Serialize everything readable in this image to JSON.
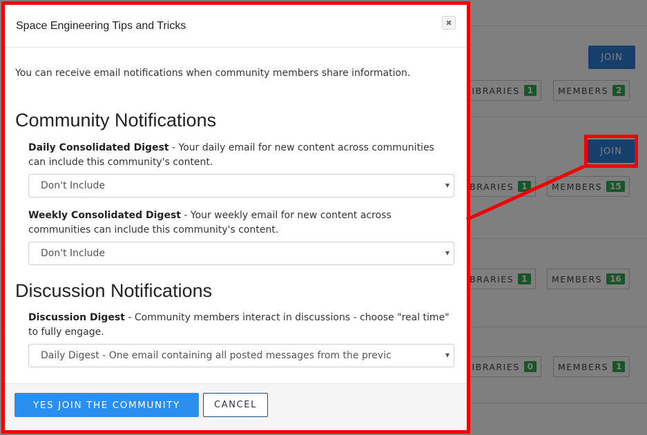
{
  "background": {
    "join_label": "JOIN",
    "libraries_label": "LIBRARIES",
    "members_label": "MEMBERS",
    "libraries_label_clipped": "IBRARIES",
    "rows": [
      {
        "libraries": "1",
        "members": "2"
      },
      {
        "libraries": "1",
        "members": "15"
      },
      {
        "libraries": "1",
        "members": "16"
      },
      {
        "libraries": "0",
        "members": "1"
      }
    ]
  },
  "modal": {
    "title": "Space Engineering Tips and Tricks",
    "close_symbol": "✖",
    "intro": "You can receive email notifications when community members share information.",
    "community_heading": "Community Notifications",
    "daily": {
      "label": "Daily Consolidated Digest",
      "desc": " - Your daily email for new content across communities can include this community's content.",
      "selected": "Don't Include"
    },
    "weekly": {
      "label": "Weekly Consolidated Digest",
      "desc": " - Your weekly email for new content across communities can include this community's content.",
      "selected": "Don't Include"
    },
    "discussion_heading": "Discussion Notifications",
    "discussion": {
      "label": "Discussion Digest",
      "desc": " - Community members interact in discussions - choose \"real time\" to fully engage.",
      "selected": "Daily Digest - One email containing all posted messages from the previc"
    },
    "yes_button": "YES JOIN THE COMMUNITY",
    "cancel_button": "CANCEL",
    "dropdown_arrow": "▼"
  },
  "colors": {
    "primary": "#2b8ff0",
    "highlight": "#f00000",
    "count_badge": "#35a853"
  }
}
